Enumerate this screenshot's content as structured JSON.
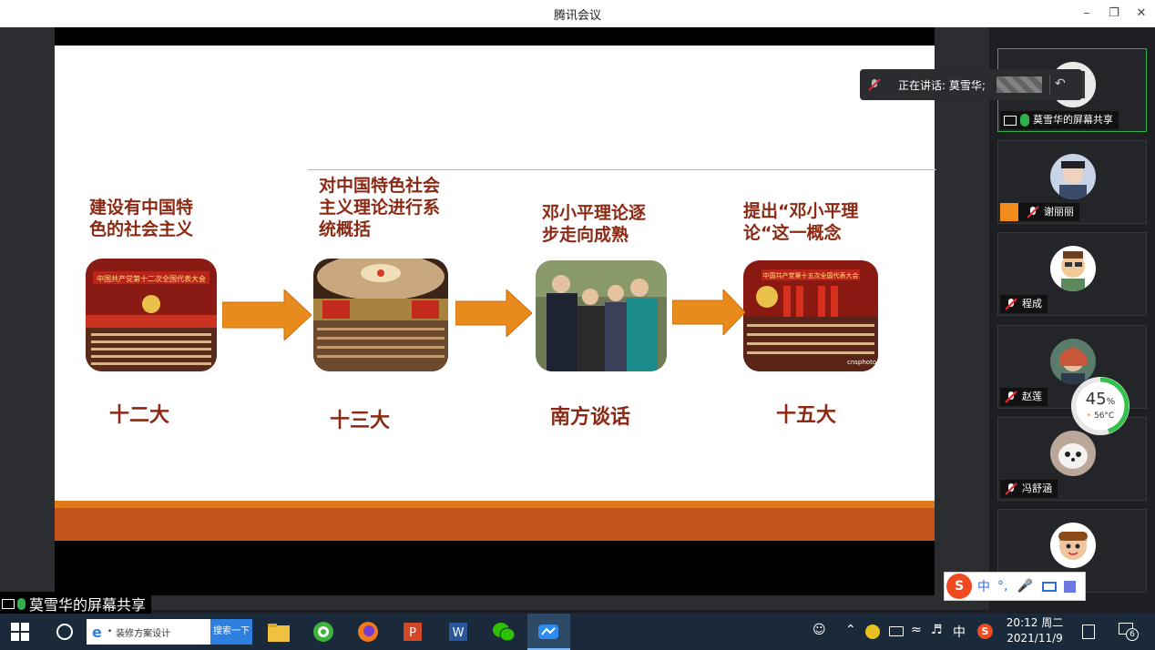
{
  "window": {
    "title": "腾讯会议",
    "minimize_icon": "minimize-icon",
    "restore_icon": "restore-icon",
    "close_icon": "close-icon"
  },
  "slide": {
    "headings": [
      {
        "line1": "建设有中国特",
        "line2": "色的社会主义"
      },
      {
        "line1": "对中国特色社会",
        "line2": "主义理论进行系",
        "line3": "统概括"
      },
      {
        "line1": "邓小平理论逐",
        "line2": "步走向成熟"
      },
      {
        "line1": "提出“邓小平理",
        "line2": "论“这一概念"
      }
    ],
    "labels": [
      "十二大",
      "十三大",
      "南方谈话",
      "十五大"
    ],
    "photo_texts": {
      "banner1": "中国共产党第十二次全国代表大会",
      "banner4": "中国共产党第十五次全国代表大会",
      "watermark": "cnsphoto"
    },
    "colors": {
      "heading": "#8b2a14",
      "arrow": "#e88a1c",
      "bottom_bar": "#c5541a"
    }
  },
  "speaking": {
    "label": "正在讲话: 莫雪华;",
    "mic_icon": "mic-muted-icon",
    "pin_icon": "return-icon"
  },
  "participants": [
    {
      "name": "莫雪华的屏幕共享",
      "active": true,
      "screen_share": true
    },
    {
      "name": "谢丽丽",
      "active": false
    },
    {
      "name": "程成",
      "active": false
    },
    {
      "name": "赵莲",
      "active": false
    },
    {
      "name": "冯舒涵",
      "active": false
    },
    {
      "name": "",
      "active": false
    }
  ],
  "gauge": {
    "percent": "45",
    "unit": "%",
    "temp": "56°C"
  },
  "share_label": "莫雪华的屏幕共享",
  "ime": {
    "mode": "中",
    "punct": "°,",
    "icons": [
      "sogou-icon",
      "mic-icon",
      "keyboard-icon",
      "grid-icon"
    ]
  },
  "taskbar": {
    "search_placeholder": "装修方案设计",
    "search_button": "搜索一下",
    "ime_lang": "中",
    "clock_time": "20:12 周二",
    "clock_date": "2021/11/9",
    "notification_count": "6"
  }
}
